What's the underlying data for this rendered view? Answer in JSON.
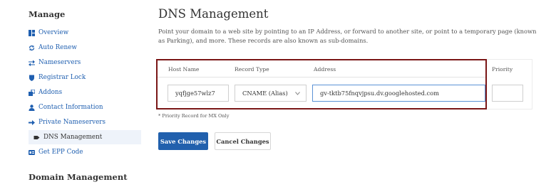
{
  "sidebar": {
    "title": "Manage",
    "items": [
      {
        "label": "Overview",
        "icon": "overview-icon"
      },
      {
        "label": "Auto Renew",
        "icon": "auto-renew-icon"
      },
      {
        "label": "Nameservers",
        "icon": "nameservers-icon"
      },
      {
        "label": "Registrar Lock",
        "icon": "shield-icon"
      },
      {
        "label": "Addons",
        "icon": "addons-icon"
      },
      {
        "label": "Contact Information",
        "icon": "user-icon"
      },
      {
        "label": "Private Nameservers",
        "icon": "arrow-right-icon"
      },
      {
        "label": "DNS Management",
        "icon": "tag-icon"
      },
      {
        "label": "Get EPP Code",
        "icon": "id-card-icon"
      }
    ],
    "active_index": 7,
    "section2_title": "Domain Management"
  },
  "main": {
    "title": "DNS Management",
    "description": "Point your domain to a web site by pointing to an IP Address, or forward to another site, or point to a temporary page (known as Parking), and more. These records are also known as sub-domains."
  },
  "table": {
    "headers": {
      "host_name": "Host Name",
      "record_type": "Record Type",
      "address": "Address",
      "priority": "Priority"
    },
    "row": {
      "host_name": "yqfjge57wlz7",
      "record_type": "CNAME (Alias)",
      "address": "gv-tktb75fnqvjpsu.dv.googlehosted.com",
      "priority": ""
    },
    "note": "* Priority Record for MX Only"
  },
  "buttons": {
    "save": "Save Changes",
    "cancel": "Cancel Changes"
  },
  "colors": {
    "link": "#1f5fb0",
    "primary": "#2160ad",
    "highlight_border": "#7a1616",
    "active_bg": "#eef3fa"
  }
}
